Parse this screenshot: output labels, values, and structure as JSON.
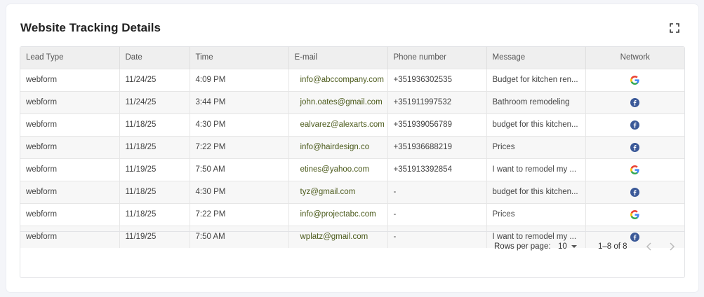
{
  "card": {
    "title": "Website Tracking Details"
  },
  "table": {
    "columns": [
      "Lead Type",
      "Date",
      "Time",
      "E-mail",
      "Phone number",
      "Message",
      "Network"
    ],
    "rows": [
      {
        "lead_type": "webform",
        "date": "11/24/25",
        "time": "4:09 PM",
        "email": "info@abccompany.com",
        "phone": "+351936302535",
        "message": "Budget for kitchen ren...",
        "network": "google"
      },
      {
        "lead_type": "webform",
        "date": "11/24/25",
        "time": "3:44 PM",
        "email": "john.oates@gmail.com",
        "phone": "+351911997532",
        "message": "Bathroom remodeling",
        "network": "facebook"
      },
      {
        "lead_type": "webform",
        "date": "11/18/25",
        "time": "4:30 PM",
        "email": "ealvarez@alexarts.com",
        "phone": "+351939056789",
        "message": "budget for this kitchen...",
        "network": "facebook"
      },
      {
        "lead_type": "webform",
        "date": "11/18/25",
        "time": "7:22 PM",
        "email": "info@hairdesign.co",
        "phone": "+351936688219",
        "message": "Prices",
        "network": "facebook"
      },
      {
        "lead_type": "webform",
        "date": "11/19/25",
        "time": "7:50 AM",
        "email": "etines@yahoo.com",
        "phone": "+351913392854",
        "message": "I want to remodel my ...",
        "network": "google"
      },
      {
        "lead_type": "webform",
        "date": "11/18/25",
        "time": "4:30 PM",
        "email": "tyz@gmail.com",
        "phone": "-",
        "message": "budget for this kitchen...",
        "network": "facebook"
      },
      {
        "lead_type": "webform",
        "date": "11/18/25",
        "time": "7:22 PM",
        "email": "info@projectabc.com",
        "phone": "-",
        "message": "Prices",
        "network": "google"
      },
      {
        "lead_type": "webform",
        "date": "11/19/25",
        "time": "7:50 AM",
        "email": "wplatz@gmail.com",
        "phone": "-",
        "message": "I want to remodel my ...",
        "network": "facebook"
      }
    ]
  },
  "pagination": {
    "rows_per_page_label": "Rows per page:",
    "rows_per_page_value": "10",
    "range_label": "1–8 of 8"
  },
  "icons": {
    "expand": "fullscreen-icon",
    "google": "google-icon",
    "facebook": "facebook-icon",
    "prev": "chevron-left-icon",
    "next": "chevron-right-icon"
  },
  "colors": {
    "facebook_blue": "#3b5998",
    "email_text": "#4c5b1c",
    "header_bg": "#efefef"
  }
}
